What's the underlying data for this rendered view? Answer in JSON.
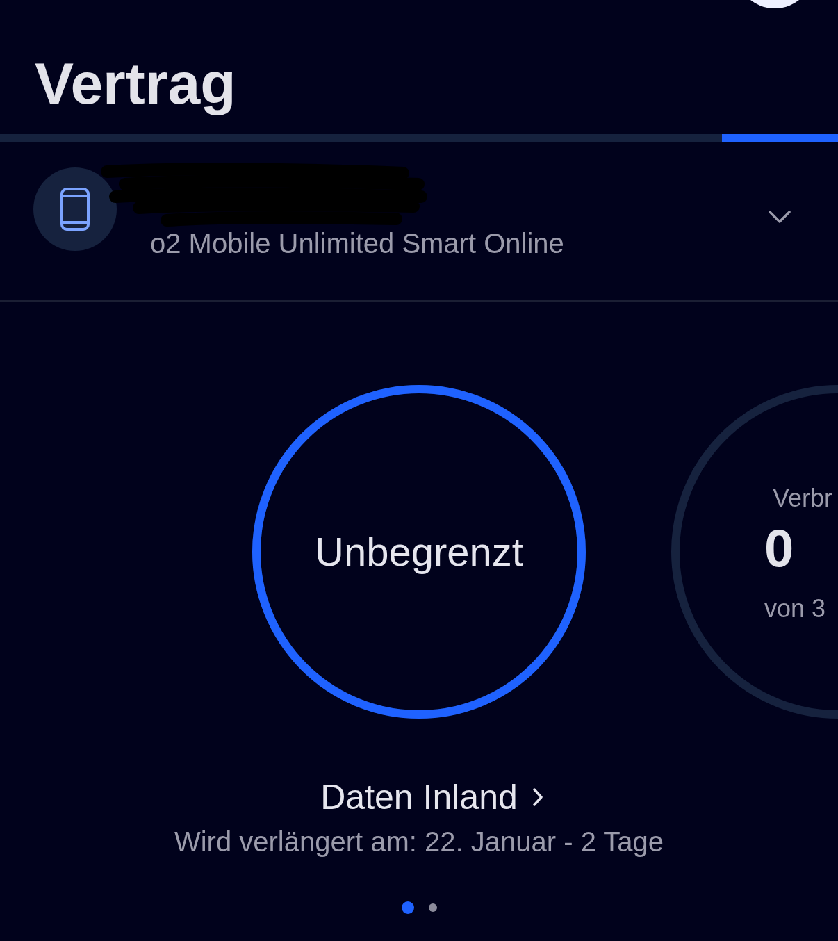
{
  "header": {
    "title": "Vertrag"
  },
  "contract": {
    "plan": "o2 Mobile Unlimited Smart Online",
    "expanded": false
  },
  "usage_cards": [
    {
      "kind": "unlimited",
      "value": "Unbegrenzt",
      "level": 1
    },
    {
      "kind": "metered",
      "label": "Verbr",
      "value": "0",
      "limit": "von 3"
    }
  ],
  "usage_title": "Daten Inland",
  "renewal": "Wird verlängert am: 22. Januar - 2 Tage",
  "pager": [
    {
      "selected": true
    },
    {
      "selected": false
    }
  ]
}
